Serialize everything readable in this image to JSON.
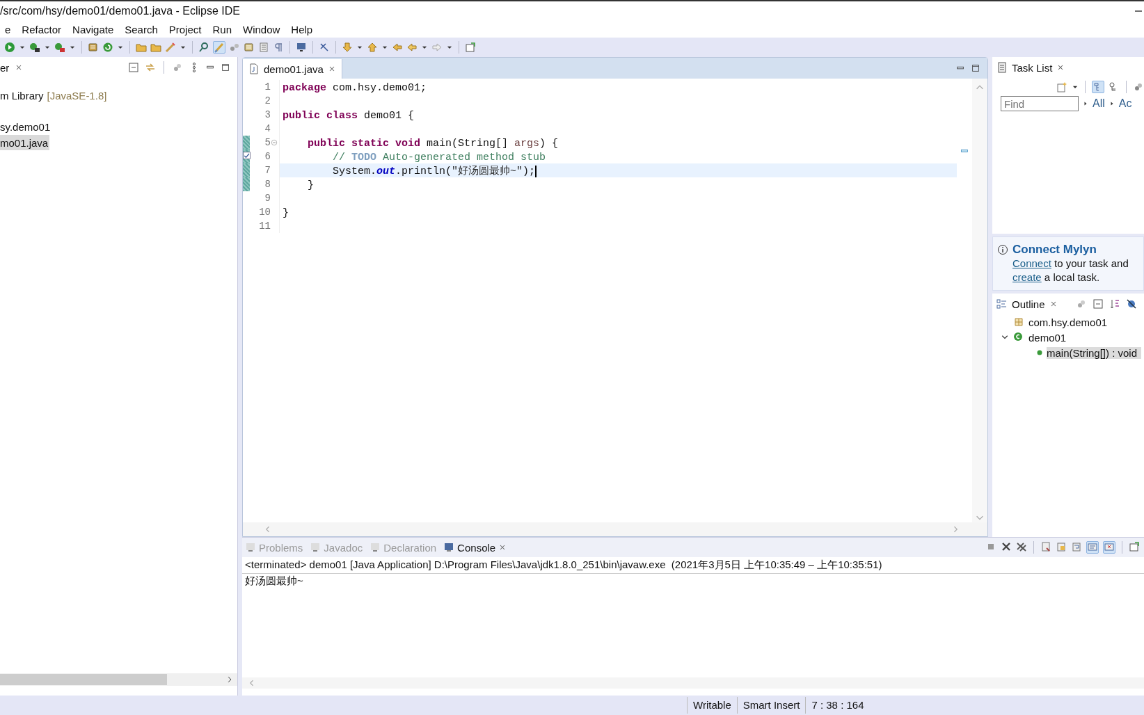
{
  "window": {
    "title": "/src/com/hsy/demo01/demo01.java - Eclipse IDE"
  },
  "menu": [
    "e",
    "Refactor",
    "Navigate",
    "Search",
    "Project",
    "Run",
    "Window",
    "Help"
  ],
  "package_explorer": {
    "tab": "er",
    "items": [
      {
        "label": "m Library",
        "suffix": "[JavaSE-1.8]",
        "selected": false
      },
      {
        "label": "sy.demo01",
        "selected": false
      },
      {
        "label": "mo01.java",
        "selected": true
      }
    ]
  },
  "editor": {
    "tab": "demo01.java",
    "lines": [
      {
        "number": "1",
        "current": false,
        "changed": false,
        "foldable": false,
        "task": false,
        "segments": [
          {
            "text": "package",
            "kind": "keyword"
          },
          {
            "text": " com.hsy.demo01;",
            "kind": "plain"
          }
        ]
      },
      {
        "number": "2",
        "current": false,
        "changed": false,
        "foldable": false,
        "task": false
      },
      {
        "number": "3",
        "current": false,
        "changed": false,
        "foldable": false,
        "task": false,
        "segments": [
          {
            "text": "public class",
            "kind": "keyword"
          },
          {
            "text": " demo01 {",
            "kind": "plain"
          }
        ]
      },
      {
        "number": "4",
        "current": false,
        "changed": false,
        "foldable": false,
        "task": false
      },
      {
        "number": "5",
        "current": false,
        "changed": true,
        "foldable": true,
        "task": false,
        "segments": [
          {
            "text": "    public static void",
            "kind": "keyword"
          },
          {
            "text": " main(String[] ",
            "kind": "plain"
          },
          {
            "text": "args",
            "kind": "param"
          },
          {
            "text": ") {",
            "kind": "plain"
          }
        ]
      },
      {
        "number": "6",
        "current": false,
        "changed": true,
        "foldable": false,
        "task": true,
        "segments": [
          {
            "text": "        // ",
            "kind": "comment"
          },
          {
            "text": "TODO",
            "kind": "todo"
          },
          {
            "text": " Auto-generated method stub",
            "kind": "comment"
          }
        ]
      },
      {
        "number": "7",
        "current": true,
        "changed": true,
        "foldable": false,
        "task": false,
        "segments": [
          {
            "text": "        System.",
            "kind": "plain"
          },
          {
            "text": "out",
            "kind": "field"
          },
          {
            "text": ".println(",
            "kind": "plain"
          },
          {
            "text": "\"好汤圆最帅~\"",
            "kind": "string"
          },
          {
            "text": ");",
            "kind": "plain"
          }
        ]
      },
      {
        "number": "8",
        "current": false,
        "changed": true,
        "foldable": false,
        "task": false,
        "segments": [
          {
            "text": "    }",
            "kind": "plain"
          }
        ]
      },
      {
        "number": "9",
        "current": false,
        "changed": false,
        "foldable": false,
        "task": false
      },
      {
        "number": "10",
        "current": false,
        "changed": false,
        "foldable": false,
        "task": false,
        "segments": [
          {
            "text": "}",
            "kind": "plain"
          }
        ]
      },
      {
        "number": "11",
        "current": false,
        "changed": false,
        "foldable": false,
        "task": false
      }
    ]
  },
  "task_list": {
    "tab": "Task List",
    "find_placeholder": "Find",
    "filters": [
      "All",
      "Ac"
    ]
  },
  "mylyn": {
    "title": "Connect Mylyn",
    "lines": [
      [
        {
          "text": "Connect",
          "link": true
        },
        {
          "text": " to your task and",
          "link": false
        }
      ],
      [
        {
          "text": "create",
          "link": true
        },
        {
          "text": " a local task.",
          "link": false
        }
      ]
    ]
  },
  "outline": {
    "tab": "Outline",
    "tree": [
      {
        "label": "com.hsy.demo01",
        "kind": "package",
        "selected": false
      },
      {
        "label": "demo01",
        "kind": "class",
        "selected": false,
        "expanded": true,
        "children": [
          {
            "label": "main(String[]) : void",
            "kind": "method",
            "selected": true
          }
        ]
      }
    ]
  },
  "console": {
    "tabs": [
      {
        "label": "Problems",
        "selected": false
      },
      {
        "label": "Javadoc",
        "selected": false
      },
      {
        "label": "Declaration",
        "selected": false
      },
      {
        "label": "Console",
        "selected": true
      }
    ],
    "header": "<terminated> demo01 [Java Application] D:\\Program Files\\Java\\jdk1.8.0_251\\bin\\javaw.exe  (2021年3月5日 上午10:35:49 – 上午10:35:51)",
    "output": "好汤圆最帅~"
  },
  "status_bar": [
    "Writable",
    "Smart Insert",
    "7 : 38 : 164"
  ]
}
